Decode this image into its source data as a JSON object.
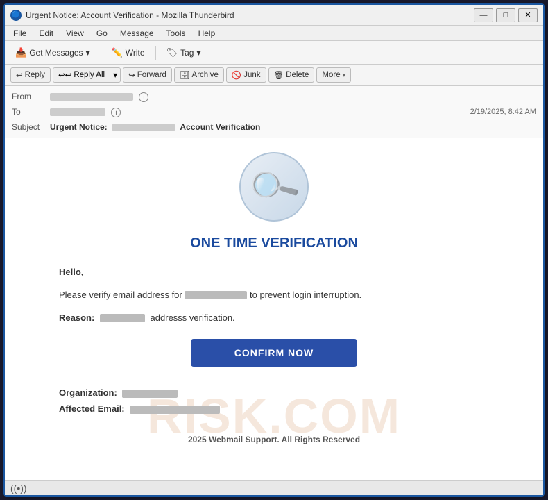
{
  "window": {
    "title": "Urgent Notice: Account Verification - Mozilla Thunderbird",
    "icon": "🔵"
  },
  "titlebar": {
    "minimize": "—",
    "maximize": "□",
    "close": "✕"
  },
  "menubar": {
    "items": [
      "File",
      "Edit",
      "View",
      "Go",
      "Message",
      "Tools",
      "Help"
    ]
  },
  "toolbar": {
    "get_messages_label": "Get Messages",
    "write_label": "Write",
    "tag_label": "Tag"
  },
  "actions": {
    "reply": "Reply",
    "reply_all": "Reply All",
    "forward": "Forward",
    "archive": "Archive",
    "junk": "Junk",
    "delete": "Delete",
    "more": "More"
  },
  "email_header": {
    "from_label": "From",
    "to_label": "To",
    "subject_label": "Subject",
    "subject_prefix": "Urgent Notice:",
    "subject_suffix": "Account Verification",
    "timestamp": "2/19/2025, 8:42 AM"
  },
  "email_body": {
    "title": "ONE TIME VERIFICATION",
    "greeting": "Hello,",
    "body_text": "Please verify email address for",
    "body_text2": "to prevent login interruption.",
    "reason_label": "Reason:",
    "reason_suffix": "addresss verification.",
    "confirm_button": "CONFIRM NOW",
    "org_label": "Organization:",
    "affected_label": "Affected Email:",
    "footer": "2025 Webmail Support. All Rights Reserved",
    "watermark": "RISK.COM"
  },
  "statusbar": {
    "icon": "((•))",
    "text": ""
  }
}
